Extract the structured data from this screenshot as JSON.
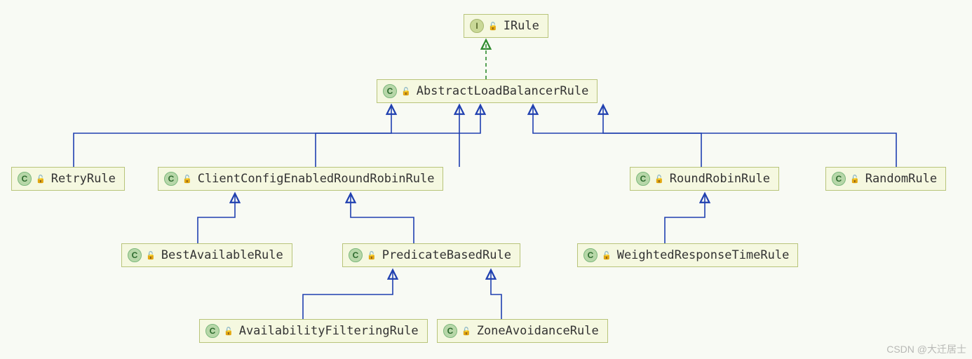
{
  "nodes": {
    "irule": {
      "label": "IRule",
      "kind": "I"
    },
    "abstract": {
      "label": "AbstractLoadBalancerRule",
      "kind": "C"
    },
    "retry": {
      "label": "RetryRule",
      "kind": "C"
    },
    "clientcfg": {
      "label": "ClientConfigEnabledRoundRobinRule",
      "kind": "C"
    },
    "roundrobin": {
      "label": "RoundRobinRule",
      "kind": "C"
    },
    "random": {
      "label": "RandomRule",
      "kind": "C"
    },
    "bestavail": {
      "label": "BestAvailableRule",
      "kind": "C"
    },
    "predicate": {
      "label": "PredicateBasedRule",
      "kind": "C"
    },
    "weighted": {
      "label": "WeightedResponseTimeRule",
      "kind": "C"
    },
    "availfilt": {
      "label": "AvailabilityFilteringRule",
      "kind": "C"
    },
    "zoneavoid": {
      "label": "ZoneAvoidanceRule",
      "kind": "C"
    }
  },
  "watermark": "CSDN @大迁居士",
  "chart_data": {
    "type": "hierarchy-diagram",
    "title": "",
    "edges": [
      {
        "from": "AbstractLoadBalancerRule",
        "to": "IRule",
        "style": "dashed-implements"
      },
      {
        "from": "RetryRule",
        "to": "AbstractLoadBalancerRule",
        "style": "solid-extends"
      },
      {
        "from": "ClientConfigEnabledRoundRobinRule",
        "to": "AbstractLoadBalancerRule",
        "style": "solid-extends"
      },
      {
        "from": "RoundRobinRule",
        "to": "AbstractLoadBalancerRule",
        "style": "solid-extends"
      },
      {
        "from": "RandomRule",
        "to": "AbstractLoadBalancerRule",
        "style": "solid-extends"
      },
      {
        "from": "BestAvailableRule",
        "to": "ClientConfigEnabledRoundRobinRule",
        "style": "solid-extends"
      },
      {
        "from": "PredicateBasedRule",
        "to": "ClientConfigEnabledRoundRobinRule",
        "style": "solid-extends"
      },
      {
        "from": "WeightedResponseTimeRule",
        "to": "RoundRobinRule",
        "style": "solid-extends"
      },
      {
        "from": "AvailabilityFilteringRule",
        "to": "PredicateBasedRule",
        "style": "solid-extends"
      },
      {
        "from": "ZoneAvoidanceRule",
        "to": "PredicateBasedRule",
        "style": "solid-extends"
      }
    ]
  }
}
